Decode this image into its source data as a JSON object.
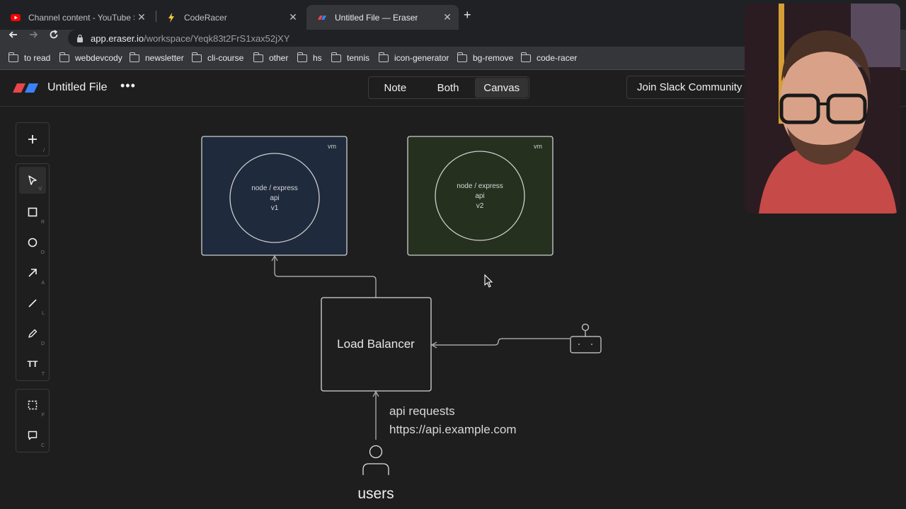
{
  "browser": {
    "tabs": [
      {
        "title": "Channel content - YouTube Stu",
        "favicon": "youtube-icon"
      },
      {
        "title": "CodeRacer",
        "favicon": "lightning-icon"
      },
      {
        "title": "Untitled File — Eraser",
        "favicon": "eraser-icon"
      }
    ],
    "new_tab_glyph": "+",
    "close_glyph": "✕",
    "url_host": "app.eraser.io",
    "url_path": "/workspace/Yeqk83t2FrS1xax52jXY",
    "bookmarks": [
      "to read",
      "webdevcody",
      "newsletter",
      "cli-course",
      "other",
      "hs",
      "tennis",
      "icon-generator",
      "bg-remove",
      "code-racer"
    ]
  },
  "app": {
    "file_title": "Untitled File",
    "menu_glyph": "•••",
    "modes": [
      "Note",
      "Both",
      "Canvas"
    ],
    "selected_mode": "Canvas",
    "slack_label": "Join Slack Community",
    "tools": [
      {
        "name": "add",
        "key": "/"
      },
      {
        "name": "select",
        "key": "V"
      },
      {
        "name": "rectangle",
        "key": "R"
      },
      {
        "name": "circle",
        "key": "O"
      },
      {
        "name": "arrow",
        "key": "A"
      },
      {
        "name": "line",
        "key": "L"
      },
      {
        "name": "pencil",
        "key": "D"
      },
      {
        "name": "text",
        "key": "T"
      },
      {
        "name": "frame",
        "key": "F"
      },
      {
        "name": "comment",
        "key": "C"
      }
    ],
    "text_tool_glyph": "TT"
  },
  "canvas": {
    "vm1": {
      "tag": "vm",
      "line1": "node / express",
      "line2": "api",
      "line3": "v1",
      "fill": "#1f2a3c"
    },
    "vm2": {
      "tag": "vm",
      "line1": "node / express",
      "line2": "api",
      "line3": "v2",
      "fill": "#26301f"
    },
    "load_balancer": "Load Balancer",
    "api_note_line1": "api requests",
    "api_note_line2": "https://api.example.com",
    "users_label": "users"
  }
}
